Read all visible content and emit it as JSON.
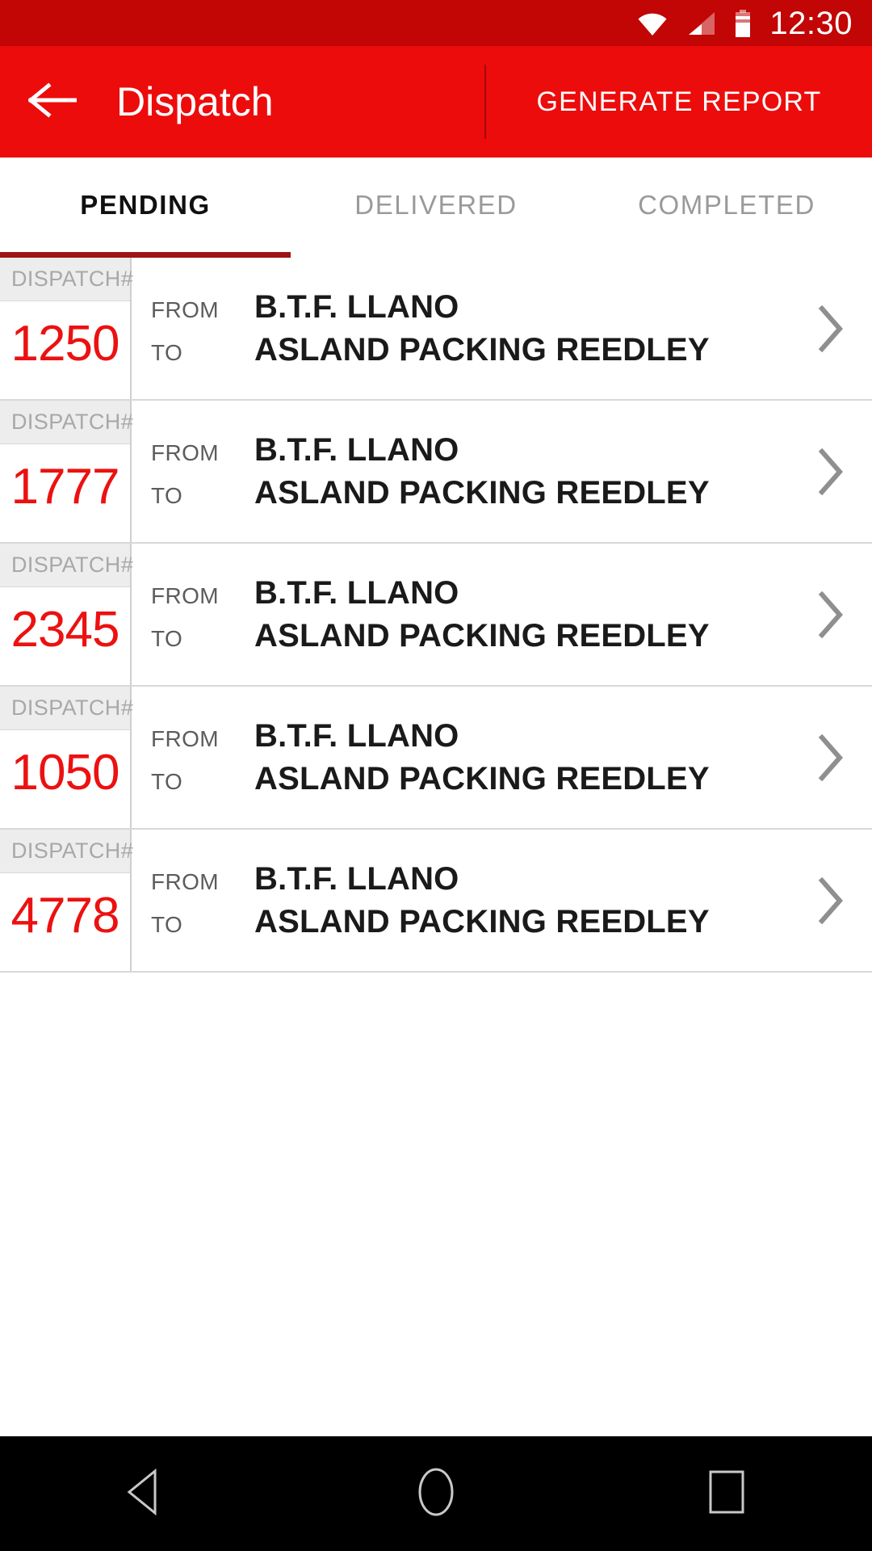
{
  "status_bar": {
    "time": "12:30",
    "icons": [
      "wifi-icon",
      "cellular-signal-icon",
      "battery-icon"
    ],
    "background": "#c20505"
  },
  "app_bar": {
    "back_icon": "arrow-left-icon",
    "title": "Dispatch",
    "action_label": "GENERATE REPORT",
    "background": "#ec0c0c"
  },
  "tabs": {
    "active_index": 0,
    "indicator_color": "#9e1313",
    "items": [
      {
        "label": "PENDING"
      },
      {
        "label": "DELIVERED"
      },
      {
        "label": "COMPLETED"
      }
    ]
  },
  "list": {
    "dispatch_label": "DISPATCH#",
    "from_label": "FROM",
    "to_label": "TO",
    "chevron_icon": "chevron-right-icon",
    "number_color": "#ec1111",
    "rows": [
      {
        "number": "1250",
        "from": "B.T.F. LLANO",
        "to": "ASLAND PACKING REEDLEY"
      },
      {
        "number": "1777",
        "from": "B.T.F. LLANO",
        "to": "ASLAND PACKING REEDLEY"
      },
      {
        "number": "2345",
        "from": "B.T.F. LLANO",
        "to": "ASLAND PACKING REEDLEY"
      },
      {
        "number": "1050",
        "from": "B.T.F. LLANO",
        "to": "ASLAND PACKING REEDLEY"
      },
      {
        "number": "4778",
        "from": "B.T.F. LLANO",
        "to": "ASLAND PACKING REEDLEY"
      }
    ]
  },
  "nav_bar": {
    "back_icon": "nav-back-triangle-icon",
    "home_icon": "nav-home-circle-icon",
    "recents_icon": "nav-recents-square-icon"
  }
}
